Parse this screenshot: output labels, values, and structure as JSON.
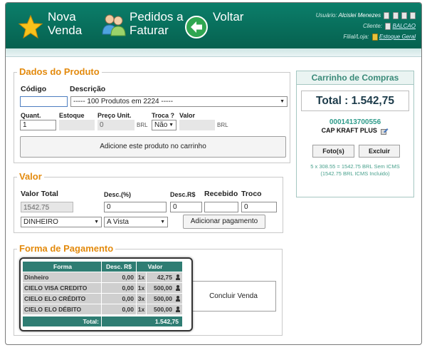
{
  "header": {
    "nova_venda": "Nova Venda",
    "pedidos_a_faturar": "Pedidos a Faturar",
    "voltar": "Voltar",
    "usuario_label": "Usuário:",
    "usuario_value": "Alcislei Menezes",
    "cliente_label": "Cliente:",
    "cliente_value": "BALCAO",
    "filial_label": "Filial/Loja:",
    "filial_value": "Estoque Geral"
  },
  "produto": {
    "legend": "Dados do Produto",
    "codigo_label": "Código",
    "codigo_value": "",
    "descricao_label": "Descrição",
    "descricao_value": "----- 100 Produtos em 2224 -----",
    "quant_label": "Quant.",
    "quant_value": "1",
    "estoque_label": "Estoque",
    "preco_label": "Preço Unit.",
    "preco_value": "0",
    "preco_unit": "BRL",
    "troca_label": "Troca ?",
    "troca_value": "Não",
    "valor_label": "Valor",
    "valor_unit": "BRL",
    "add_button": "Adicione este produto no carrinho"
  },
  "valor": {
    "legend": "Valor",
    "total_label": "Valor Total",
    "total_value": "1542.75",
    "desc_pct_label": "Desc.(%)",
    "desc_pct_value": "0",
    "desc_rs_label": "Desc.R$",
    "desc_rs_value": "0",
    "recebido_label": "Recebido",
    "recebido_value": "",
    "troco_label": "Troco",
    "troco_value": "0",
    "forma_select": "DINHEIRO",
    "prazo_select": "A Vista",
    "add_pagamento": "Adicionar pagamento"
  },
  "pagamento": {
    "legend": "Forma de Pagamento",
    "headers": [
      "Forma",
      "Desc. R$",
      "Valor"
    ],
    "rows": [
      {
        "forma": "Dinheiro",
        "desc": "0,00",
        "qty": "1x",
        "valor": "42,75"
      },
      {
        "forma": "CIELO VISA CREDITO",
        "desc": "0,00",
        "qty": "1x",
        "valor": "500,00"
      },
      {
        "forma": "CIELO ELO CRÉDITO",
        "desc": "0,00",
        "qty": "3x",
        "valor": "500,00"
      },
      {
        "forma": "CIELO ELO DÉBITO",
        "desc": "0,00",
        "qty": "1x",
        "valor": "500,00"
      }
    ],
    "total_label": "Total:",
    "total_value": "1.542,75",
    "concluir": "Concluir Venda"
  },
  "carrinho": {
    "title": "Carrinho de Compras",
    "total": "Total :  1.542,75",
    "codigo": "0001413700556",
    "nome": "CAP KRAFT PLUS",
    "fotos_button": "Foto(s)",
    "excluir_button": "Excluir",
    "descricao": "5 x 308.55 = 1542.75 BRL Sem ICMS (1542.75 BRL ICMS Incluido)"
  },
  "colors": {
    "header": "#0b7e6a",
    "legend": "#e38a0d",
    "accent": "#2f7d73",
    "cart_title": "#3a8a79"
  }
}
